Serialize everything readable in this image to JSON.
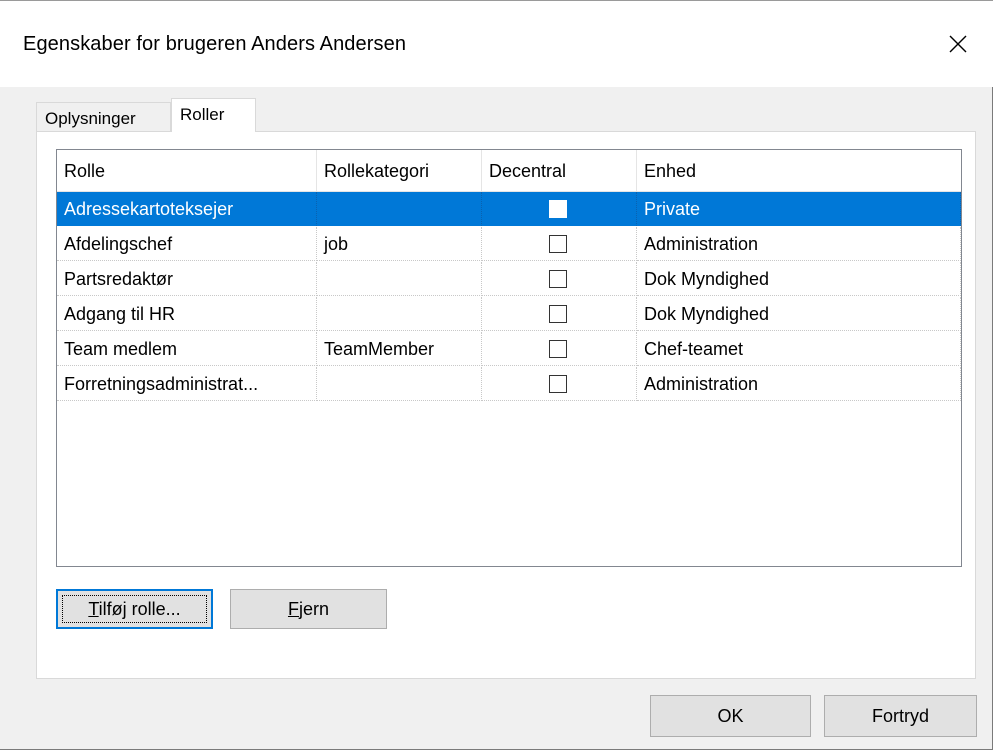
{
  "window": {
    "title": "Egenskaber for brugeren Anders Andersen"
  },
  "tabs": [
    {
      "label": "Oplysninger",
      "active": false
    },
    {
      "label": "Roller",
      "active": true
    }
  ],
  "roles_table": {
    "columns": [
      "Rolle",
      "Rollekategori",
      "Decentral",
      "Enhed"
    ],
    "rows": [
      {
        "rolle": "Adressekartoteksejer",
        "kategori": "",
        "decentral": false,
        "enhed": "Private",
        "selected": true
      },
      {
        "rolle": "Afdelingschef",
        "kategori": "job",
        "decentral": false,
        "enhed": "Administration",
        "selected": false
      },
      {
        "rolle": "Partsredaktør",
        "kategori": "",
        "decentral": false,
        "enhed": "Dok Myndighed",
        "selected": false
      },
      {
        "rolle": "Adgang til HR",
        "kategori": "",
        "decentral": false,
        "enhed": "Dok Myndighed",
        "selected": false
      },
      {
        "rolle": "Team medlem",
        "kategori": "TeamMember",
        "decentral": false,
        "enhed": "Chef-teamet",
        "selected": false
      },
      {
        "rolle": "Forretningsadministrat...",
        "kategori": "",
        "decentral": false,
        "enhed": "Administration",
        "selected": false
      }
    ]
  },
  "buttons": {
    "add_role": {
      "mnemonic": "T",
      "rest": "ilføj rolle..."
    },
    "remove": {
      "mnemonic": "F",
      "rest": "jern"
    },
    "ok": "OK",
    "cancel": "Fortryd"
  },
  "icons": {
    "close": "close-icon"
  },
  "colors": {
    "selection": "#0078d7",
    "dialog_bg": "#f0f0f0",
    "button_bg": "#e1e1e1"
  }
}
